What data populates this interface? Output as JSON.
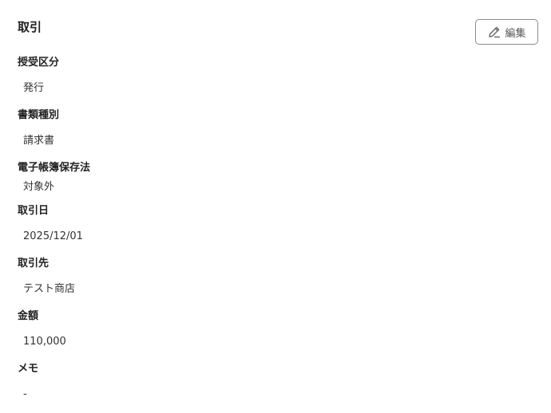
{
  "panel": {
    "title": "取引",
    "edit_label": "編集"
  },
  "fields": [
    {
      "label": "授受区分",
      "value": "発行"
    },
    {
      "label": "書類種別",
      "value": "請求書"
    },
    {
      "label": "電子帳簿保存法",
      "value": "対象外"
    },
    {
      "label": "取引日",
      "value": "2025/12/01"
    },
    {
      "label": "取引先",
      "value": "テスト商店"
    },
    {
      "label": "金額",
      "value": "110,000"
    },
    {
      "label": "メモ",
      "value": "-"
    }
  ]
}
